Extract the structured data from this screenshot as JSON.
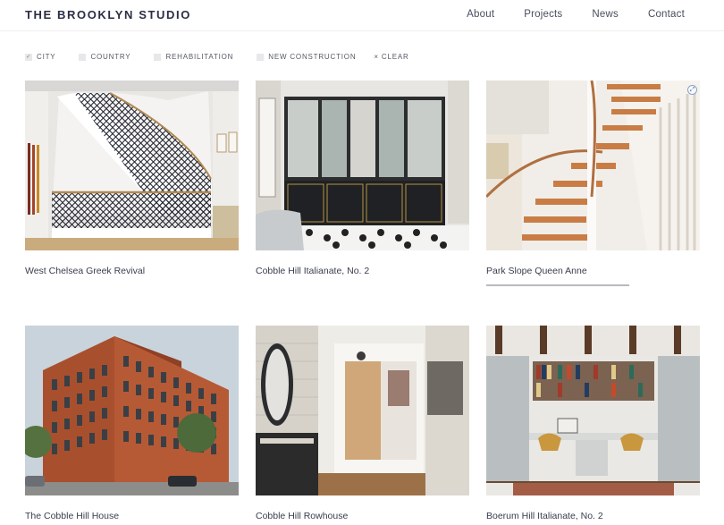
{
  "header": {
    "logo": "THE BROOKLYN STUDIO",
    "nav": [
      "About",
      "Projects",
      "News",
      "Contact"
    ]
  },
  "filters": {
    "items": [
      {
        "label": "CITY",
        "checked": true
      },
      {
        "label": "COUNTRY",
        "checked": false
      },
      {
        "label": "REHABILITATION",
        "checked": false
      },
      {
        "label": "NEW CONSTRUCTION",
        "checked": false
      }
    ],
    "clear_label": "CLEAR",
    "check_glyph": "✓",
    "clear_glyph": "×"
  },
  "projects": [
    {
      "title": "West Chelsea Greek Revival",
      "image": "spiral-staircase-netted-rail"
    },
    {
      "title": "Cobble Hill Italianate, No. 2",
      "image": "bathroom-double-vanity"
    },
    {
      "title": "Park Slope Queen Anne",
      "image": "wood-staircase",
      "hovered": true
    },
    {
      "title": "The Cobble Hill House",
      "image": "brick-warehouse-exterior"
    },
    {
      "title": "Cobble Hill Rowhouse",
      "image": "entry-hall-mirror"
    },
    {
      "title": "Boerum Hill Italianate, No. 2",
      "image": "study-bookshelves-desk"
    }
  ]
}
